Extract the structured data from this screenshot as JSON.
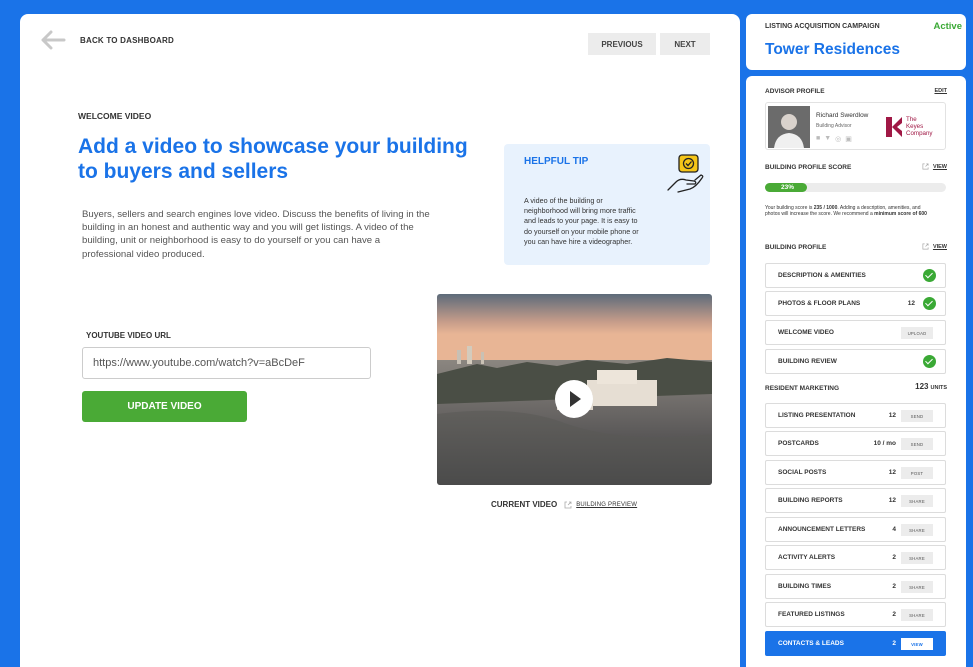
{
  "nav": {
    "back_label": "BACK TO DASHBOARD",
    "previous_label": "PREVIOUS",
    "next_label": "NEXT"
  },
  "main": {
    "section_label": "WELCOME VIDEO",
    "headline": "Add a video to showcase your building to buyers and sellers",
    "description": "Buyers, sellers and search engines love video. Discuss the benefits of living in the building in an honest and authentic way and you will get listings. A video of the building, unit or neighborhood is easy to do yourself or you can have a professional video produced.",
    "tip_title": "HELPFUL TIP",
    "tip_body": "A video of the building or neighborhood will bring more traffic and leads to your page. It is easy to do yourself on your mobile phone or you can have hire a videographer.",
    "youtube_label": "YOUTUBE VIDEO URL",
    "youtube_value": "https://www.youtube.com/watch?v=aBcDeF",
    "update_label": "UPDATE VIDEO",
    "current_video_label": "CURRENT VIDEO",
    "preview_link": "BUILDING PREVIEW"
  },
  "campaign": {
    "title": "LISTING ACQUISITION CAMPAIGN",
    "status": "Active",
    "name": "Tower Residences"
  },
  "advisor": {
    "heading": "ADVISOR PROFILE",
    "edit_label": "EDIT",
    "name": "Richard Swerdlow",
    "role": "Building Advisor",
    "company_line1": "The",
    "company_line2": "Keyes",
    "company_line3": "Company"
  },
  "score": {
    "heading": "BUILDING PROFILE SCORE",
    "view_label": "VIEW",
    "percent_label": "23%",
    "percent": 23,
    "text_prefix": "Your building score is ",
    "score": "235 / 1000",
    "text_middle": ". Adding a description, amenities, and photos will increase the score. We recommend a ",
    "minimum": "minimum score of 600"
  },
  "building_profile": {
    "heading": "BUILDING PROFILE",
    "view_label": "VIEW",
    "items": [
      {
        "label": "DESCRIPTION & AMENITIES"
      },
      {
        "label": "PHOTOS & FLOOR PLANS",
        "count": "12"
      },
      {
        "label": "WELCOME VIDEO",
        "action": "UPLOAD"
      },
      {
        "label": "BUILDING REVIEW"
      }
    ]
  },
  "resident_marketing": {
    "heading": "RESIDENT MARKETING",
    "units": "123",
    "units_label": "UNITS",
    "items": [
      {
        "label": "LISTING PRESENTATION",
        "count": "12",
        "action": "SEND"
      },
      {
        "label": "POSTCARDS",
        "count": "10 / mo",
        "action": "SEND"
      },
      {
        "label": "SOCIAL POSTS",
        "count": "12",
        "action": "POST"
      },
      {
        "label": "BUILDING REPORTS",
        "count": "12",
        "action": "SHARE"
      },
      {
        "label": "ANNOUNCEMENT LETTERS",
        "count": "4",
        "action": "SHARE"
      },
      {
        "label": "ACTIVITY ALERTS",
        "count": "2",
        "action": "SHARE"
      },
      {
        "label": "BUILDING TIMES",
        "count": "2",
        "action": "SHARE"
      },
      {
        "label": "FEATURED LISTINGS",
        "count": "2",
        "action": "SHARE"
      },
      {
        "label": "CONTACTS & LEADS",
        "count": "2",
        "action": "VIEW"
      }
    ]
  },
  "colors": {
    "brand": "#1a73e8",
    "success": "#4aaa36",
    "keyes": "#a01845"
  }
}
